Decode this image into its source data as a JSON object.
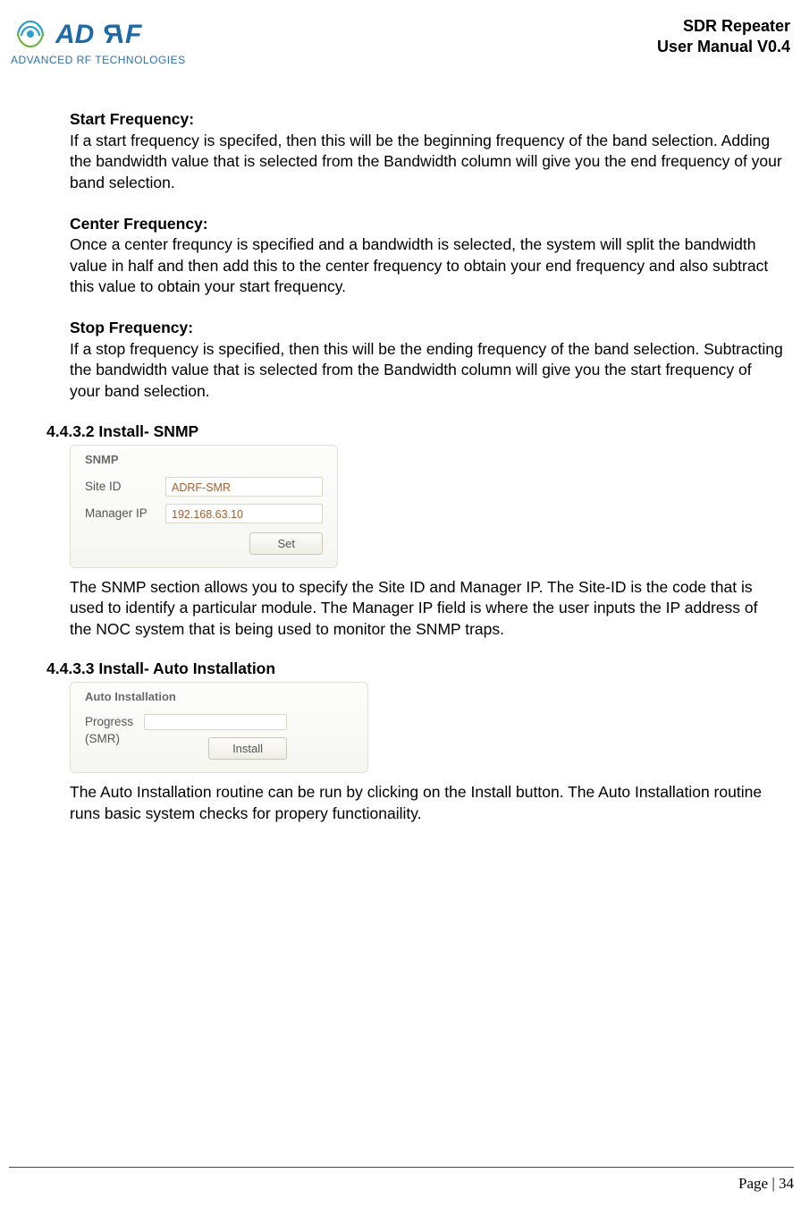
{
  "header": {
    "logo_alt": "ADRF",
    "logo_sub": "ADVANCED RF TECHNOLOGIES",
    "title_l1": "SDR Repeater",
    "title_l2": "User Manual V0.4"
  },
  "s1": {
    "h": "Start Frequency:",
    "p": "If a start frequency is specifed, then this will be the beginning frequency of the band selection.   Adding the bandwidth value that is selected from the Bandwidth column will give you the end frequency of your band selection."
  },
  "s2": {
    "h": "Center Frequency:",
    "p": "Once a center frequncy is specified and a bandwidth is selected, the system will split the bandwidth value in half and then add this to the center frequency to obtain your end frequency and also subtract this value to obtain your start frequency."
  },
  "s3": {
    "h": "Stop Frequency:",
    "p": "If a stop frequency is specified, then this will be the ending frequency of the band selection.   Subtracting the bandwidth value that is selected from the Bandwidth column will give you the start frequency of your band selection."
  },
  "snmp": {
    "heading": "4.4.3.2 Install- SNMP",
    "panel_title": "SNMP",
    "site_label": "Site ID",
    "site_value": "ADRF-SMR",
    "mgr_label": "Manager IP",
    "mgr_value": "192.168.63.10",
    "set_btn": "Set",
    "para": "The SNMP section allows you to specify the Site ID and Manager IP.   The Site-ID is the code that is used to identify a particular module.   The Manager IP field is where the user inputs the IP address of the NOC system that is being used to monitor the SNMP traps."
  },
  "auto": {
    "heading": "4.4.3.3 Install- Auto Installation",
    "panel_title": "Auto Installation",
    "progress_lbl_l1": "Progress",
    "progress_lbl_l2": "(SMR)",
    "install_btn": "Install",
    "para": "The Auto Installation routine can be run by clicking on the Install button.   The Auto Installation routine runs basic system checks for propery functionaility."
  },
  "footer": {
    "page": "Page | 34"
  }
}
